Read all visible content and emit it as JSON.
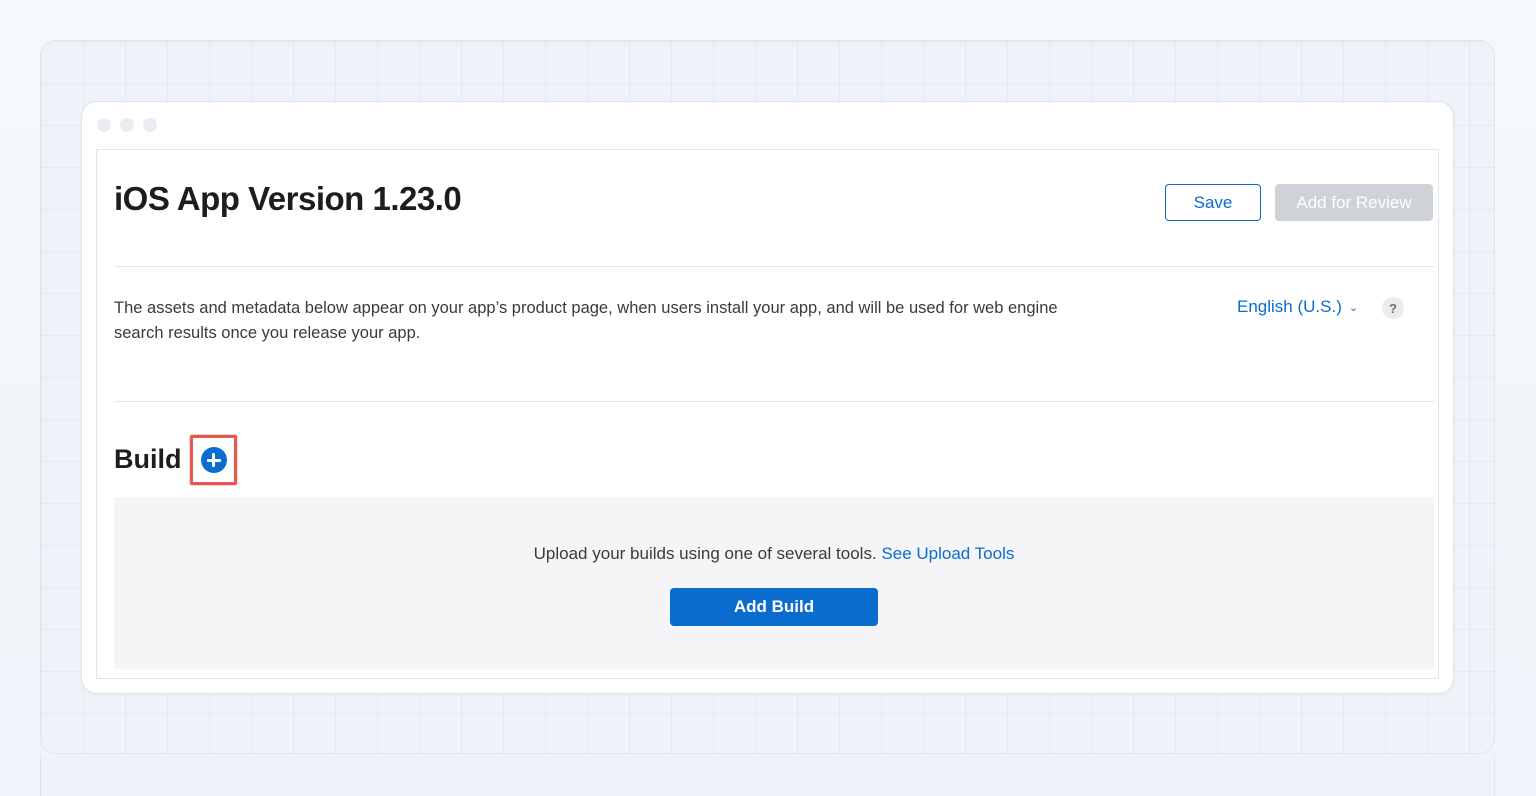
{
  "window": {
    "title": "iOS App Version 1.23.0"
  },
  "toolbar": {
    "save_label": "Save",
    "review_label": "Add for Review"
  },
  "description": {
    "line1": "The assets and metadata below appear on your app’s product page, when users install your app, and will be used for web engine",
    "line2": "search results once you release your app."
  },
  "language": {
    "selected": "English (U.S.)",
    "help_label": "?"
  },
  "build": {
    "title": "Build",
    "upload_text": "Upload your builds using one of several tools.",
    "upload_link": "See Upload Tools",
    "add_label": "Add Build"
  },
  "colors": {
    "accent": "#0a6ccf",
    "disabled_button": "#cfd2d6",
    "highlight": "#e8574e"
  },
  "icons": {
    "add_build_icon": "plus-circle-icon",
    "language_chevron": "chevron-down-icon",
    "help_icon": "question-icon"
  }
}
